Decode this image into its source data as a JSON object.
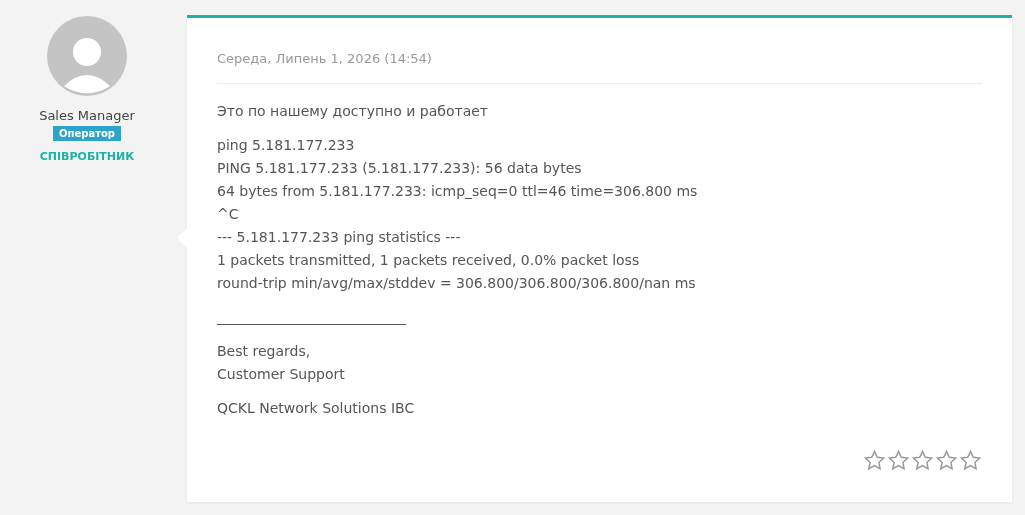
{
  "author": {
    "name": "Sales Manager",
    "badge": "Оператор",
    "role": "СПІВРОБІТНИК"
  },
  "message": {
    "date": "Середа, Липень 1, 2026 (14:54)",
    "blocks": [
      {
        "lines": [
          "Это по нашему доступно и работает"
        ]
      },
      {
        "lines": [
          "ping 5.181.177.233",
          "PING 5.181.177.233 (5.181.177.233): 56 data bytes",
          "64 bytes from 5.181.177.233: icmp_seq=0 ttl=46 time=306.800 ms",
          "^C",
          "--- 5.181.177.233 ping statistics ---",
          "1 packets transmitted, 1 packets received, 0.0% packet loss",
          "round-trip min/avg/max/stddev = 306.800/306.800/306.800/nan ms"
        ]
      },
      {
        "lines": [
          "___________________________"
        ]
      },
      {
        "lines": [
          "Best regards,",
          "Customer Support"
        ]
      },
      {
        "lines": [
          "QCKL Network Solutions IBC"
        ]
      }
    ],
    "stars": 0
  }
}
